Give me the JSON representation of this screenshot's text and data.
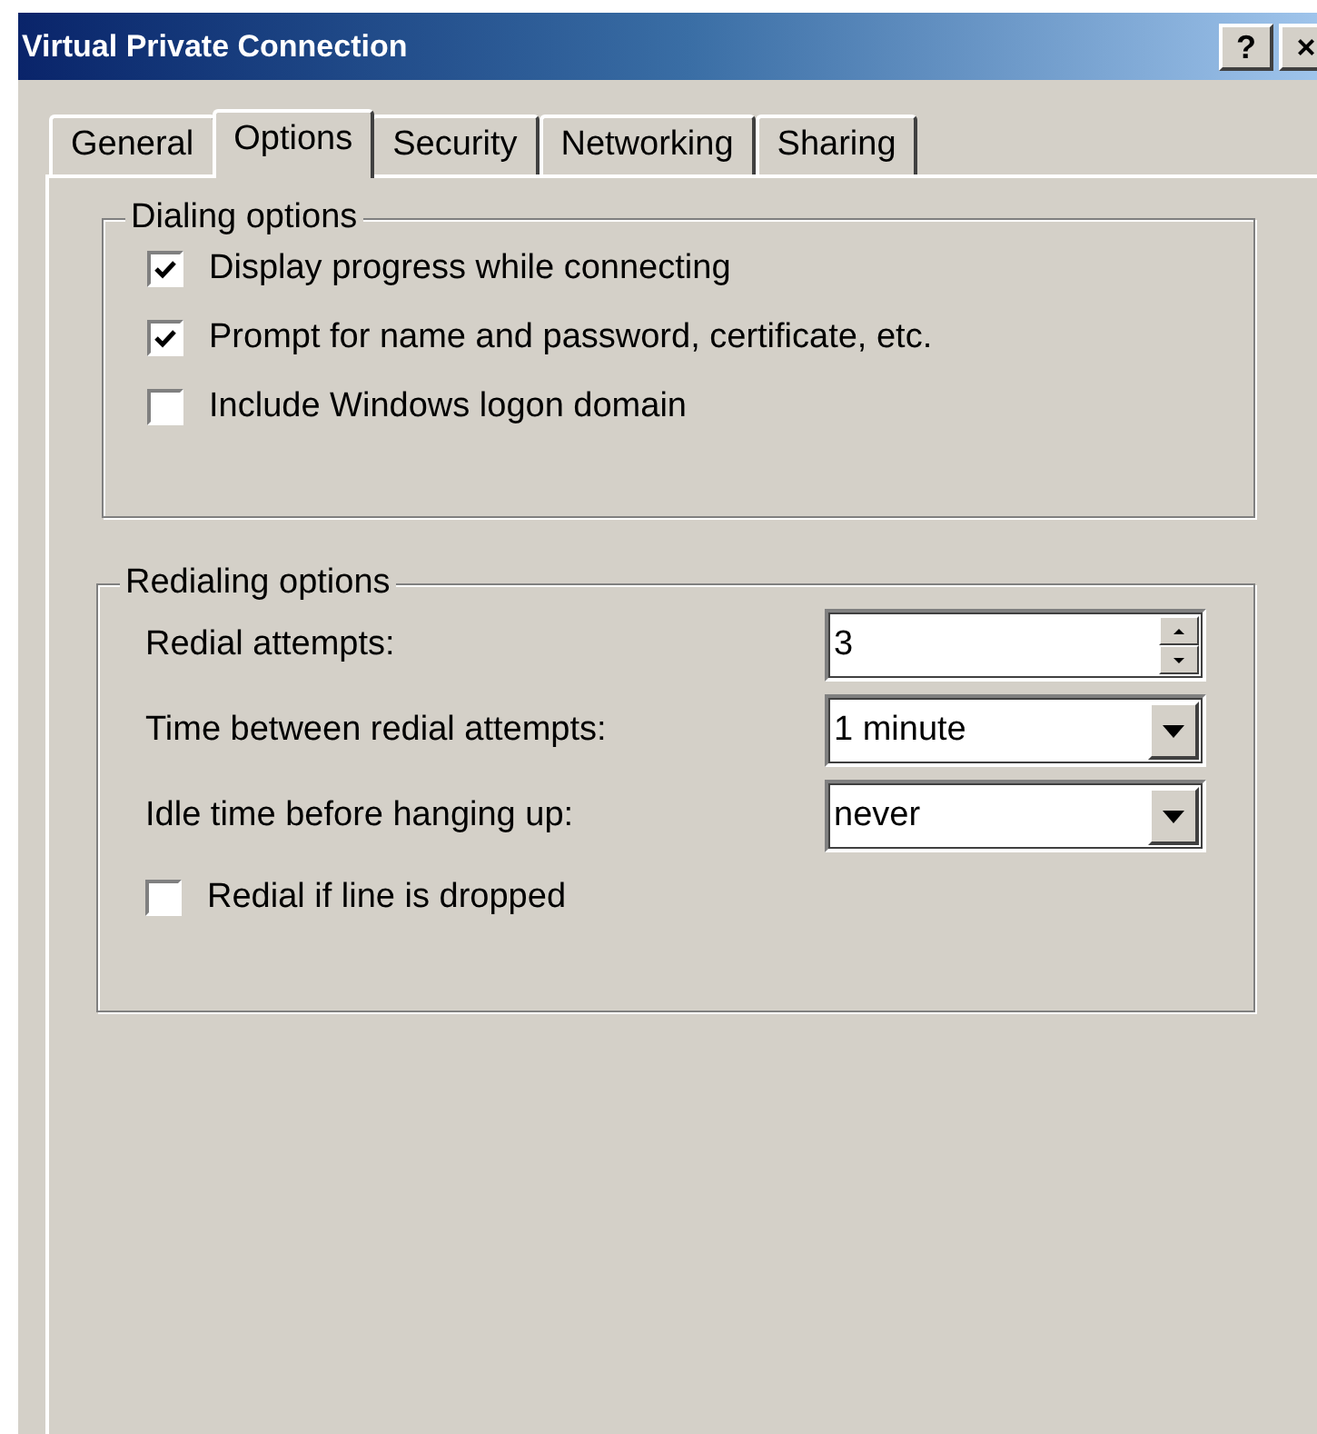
{
  "window": {
    "title": "Virtual Private Connection",
    "buttons": [
      "?",
      "×"
    ]
  },
  "tabs": [
    {
      "label": "General",
      "selected": false
    },
    {
      "label": "Options",
      "selected": true
    },
    {
      "label": "Security",
      "selected": false
    },
    {
      "label": "Networking",
      "selected": false
    },
    {
      "label": "Sharing",
      "selected": false
    }
  ],
  "dialing_options": {
    "title": "Dialing options",
    "items": [
      {
        "label": "Display progress while connecting",
        "checked": true
      },
      {
        "label": "Prompt for name and password, certificate, etc.",
        "checked": true
      },
      {
        "label": "Include Windows logon domain",
        "checked": false
      }
    ]
  },
  "redialing_options": {
    "title": "Redialing options",
    "fields": [
      {
        "kind": "spinner",
        "label": "Redial attempts:",
        "value": "3"
      },
      {
        "kind": "dropdown",
        "label": "Time between redial attempts:",
        "value": "1 minute"
      },
      {
        "kind": "dropdown",
        "label": "Idle time before hanging up:",
        "value": "never"
      }
    ],
    "items": [
      {
        "label": "Redial if line is dropped",
        "checked": false
      }
    ]
  }
}
